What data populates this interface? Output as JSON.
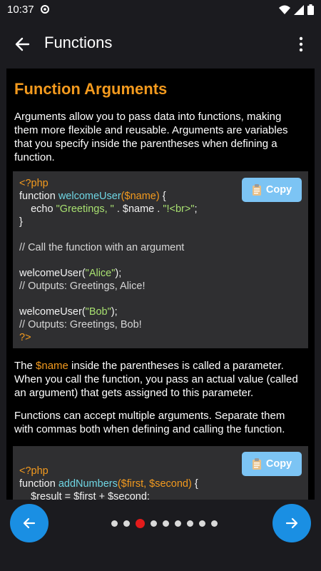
{
  "status": {
    "time": "10:37"
  },
  "appbar": {
    "title": "Functions"
  },
  "content": {
    "heading": "Function Arguments",
    "para1": "Arguments allow you to pass data into functions, making them more flexible and reusable. Arguments are variables that you specify inside the parentheses when defining a function.",
    "code1": {
      "copy_label": "Copy",
      "php_open": "<?php",
      "kw_function": "function ",
      "fn_name": "welcomeUser",
      "param": "($name)",
      "brace_open": " {",
      "echo": "    echo ",
      "str1": "\"Greetings, \"",
      "concat1": " . $name . ",
      "str2": "\"!<br>\"",
      "semi": ";",
      "brace_close": "}",
      "comment1": "// Call the function with an argument",
      "call1": "welcomeUser(",
      "arg1": "\"Alice\"",
      "call_end1": ");",
      "comment2": "// Outputs: Greetings, Alice!",
      "call2": "welcomeUser(",
      "arg2": "\"Bob\"",
      "call_end2": ");",
      "comment3": "// Outputs: Greetings, Bob!",
      "php_close": "?>"
    },
    "para2_pre": "The ",
    "para2_var": "$name",
    "para2_post": " inside the parentheses is called a parameter. When you call the function, you pass an actual value (called an argument) that gets assigned to this parameter.",
    "para3": "Functions can accept multiple arguments. Separate them with commas both when defining and calling the function.",
    "code2": {
      "copy_label": "Copy",
      "php_open": "<?php",
      "kw_function": "function ",
      "fn_name": "addNumbers",
      "param": "($first, $second)",
      "brace_open": " {",
      "line3": "    $result = $first + $second;"
    }
  },
  "pagination": {
    "total": 9,
    "current": 3
  },
  "colors": {
    "accent": "#f39a1e",
    "primary": "#1a8fe3",
    "active_dot": "#e21b1b"
  }
}
